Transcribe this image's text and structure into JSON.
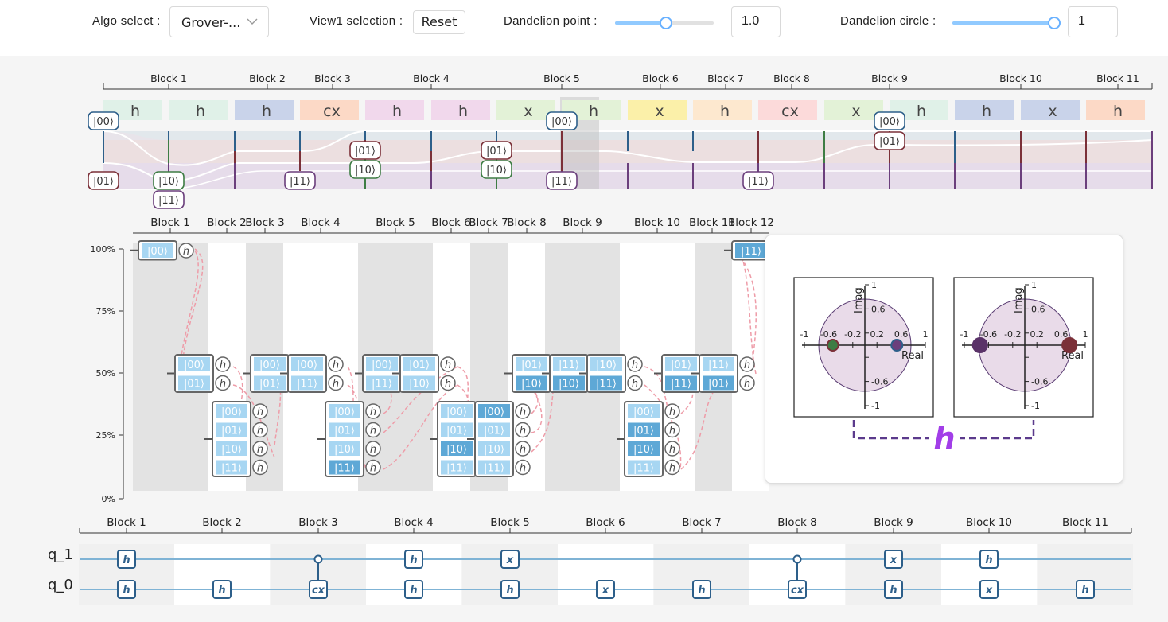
{
  "toolbar": {
    "algo_label": "Algo select :",
    "algo_value": "Grover-...",
    "view_label": "View1 selection :",
    "reset_label": "Reset",
    "dp_label": "Dandelion point :",
    "dp_value": "1.0",
    "dp_level": 0.52,
    "dc_label": "Dandelion circle :",
    "dc_value": "1",
    "dc_level": 1.0
  },
  "top_view": {
    "blocks": [
      "Block 1",
      "Block 2",
      "Block 3",
      "Block 4",
      "Block 5",
      "Block 6",
      "Block 7",
      "Block 8",
      "Block 9",
      "Block 10",
      "Block 11"
    ],
    "gates": [
      "h",
      "h",
      "h",
      "cx",
      "h",
      "h",
      "x",
      "h",
      "x",
      "h",
      "cx",
      "x",
      "h",
      "h",
      "x",
      "h"
    ],
    "states": [
      "|00⟩",
      "|01⟩",
      "|10⟩",
      "|11⟩"
    ]
  },
  "mid_view": {
    "blocks": [
      "Block 1",
      "Block 2",
      "Block 3",
      "Block 4",
      "Block 5",
      "Block 6",
      "Block 7",
      "Block 8",
      "Block 9",
      "Block 10",
      "Block 11",
      "Block 12"
    ],
    "yticks": [
      "100%",
      "75%",
      "50%",
      "25%",
      "0%"
    ],
    "states": [
      "|00⟩",
      "|01⟩",
      "|10⟩",
      "|11⟩"
    ],
    "gate_symbol": "h"
  },
  "dandelion": {
    "ylabel": "Imag",
    "xlabel": "Real",
    "ticks": [
      "-1",
      "-0.6",
      "-0.2",
      "0.2",
      "0.6",
      "1"
    ],
    "gate": "h"
  },
  "circuit": {
    "blocks": [
      "Block 1",
      "Block 2",
      "Block 3",
      "Block 4",
      "Block 5",
      "Block 6",
      "Block 7",
      "Block 8",
      "Block 9",
      "Block 10",
      "Block 11"
    ],
    "qubits": [
      "q_1",
      "q_0"
    ],
    "q1_gates": [
      "h",
      "",
      "ctrl",
      "h",
      "x",
      "",
      "",
      "ctrl",
      "x",
      "h",
      ""
    ],
    "q0_gates": [
      "h",
      "h",
      "cx",
      "h",
      "h",
      "x",
      "h",
      "cx",
      "h",
      "x",
      "h"
    ]
  }
}
